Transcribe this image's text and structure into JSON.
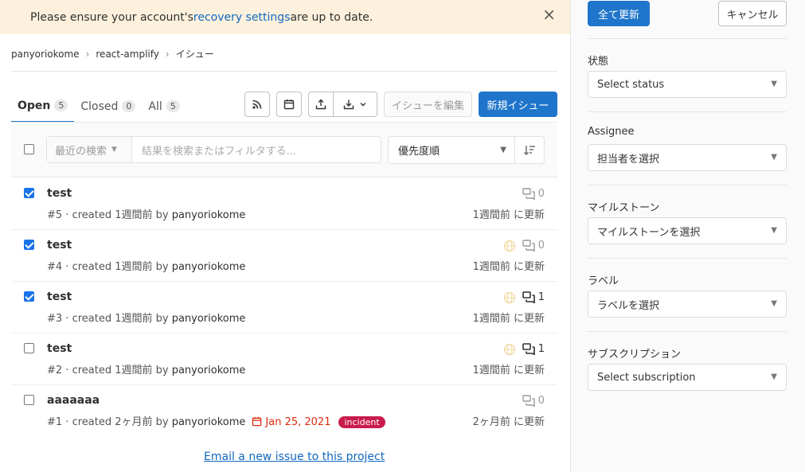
{
  "banner": {
    "text_before": "Please ensure your account's ",
    "link": "recovery settings",
    "text_after": " are up to date.",
    "close": "×"
  },
  "breadcrumb": {
    "items": [
      "panyoriokome",
      "react-amplify",
      "イシュー"
    ],
    "separator": "›"
  },
  "tabs": [
    {
      "label": "Open",
      "count": "5"
    },
    {
      "label": "Closed",
      "count": "0"
    },
    {
      "label": "All",
      "count": "5"
    }
  ],
  "toolbar": {
    "edit_label": "イシューを編集",
    "new_label": "新規イシュー"
  },
  "filter": {
    "recent_label": "最近の検索",
    "search_placeholder": "結果を検索またはフィルタする...",
    "sort_label": "優先度順"
  },
  "issues": [
    {
      "title": "test",
      "ref": "#5",
      "created": " · created 1週間前 by ",
      "author": "panyoriokome",
      "comments": "0",
      "updated": "1週間前 に更新",
      "checked": true
    },
    {
      "title": "test",
      "ref": "#4",
      "created": " · created 1週間前 by ",
      "author": "panyoriokome",
      "comments": "0",
      "updated": "1週間前 に更新",
      "checked": true
    },
    {
      "title": "test",
      "ref": "#3",
      "created": " · created 1週間前 by ",
      "author": "panyoriokome",
      "comments": "1",
      "updated": "1週間前 に更新",
      "checked": true
    },
    {
      "title": "test",
      "ref": "#2",
      "created": " · created 1週間前 by ",
      "author": "panyoriokome",
      "comments": "1",
      "updated": "1週間前 に更新",
      "checked": false
    },
    {
      "title": "aaaaaaa",
      "ref": "#1",
      "created": " · created 2ヶ月前 by ",
      "author": "panyoriokome",
      "due_date": "Jan 25, 2021",
      "label": "incident",
      "comments": "0",
      "updated": "2ヶ月前 に更新",
      "checked": false
    }
  ],
  "email_link": "Email a new issue to this project",
  "sidebar": {
    "update_all": "全て更新",
    "cancel": "キャンセル",
    "status_label": "状態",
    "status_value": "Select status",
    "assignee_label": "Assignee",
    "assignee_value": "担当者を選択",
    "milestone_label": "マイルストーン",
    "milestone_value": "マイルストーンを選択",
    "labels_label": "ラベル",
    "labels_value": "ラベルを選択",
    "subscription_label": "サブスクリプション",
    "subscription_value": "Select subscription"
  },
  "colors": {
    "primary": "#1f75cb",
    "banner_bg": "#fdf1dd",
    "link": "#1068bf",
    "danger": "#dd2b0e",
    "incident_label": "#c91c4c"
  }
}
